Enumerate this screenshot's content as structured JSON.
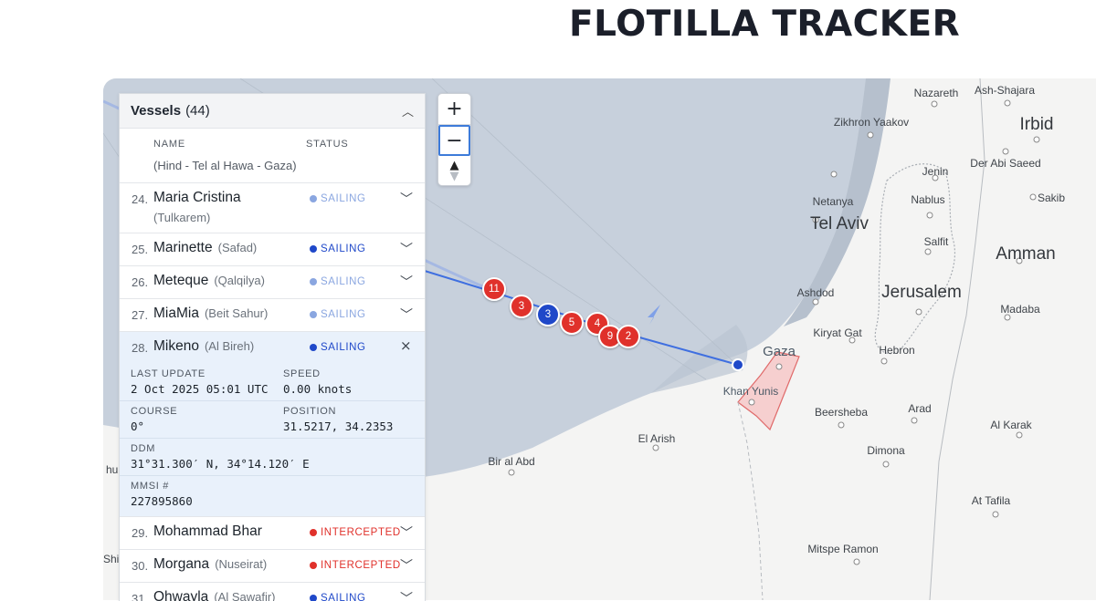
{
  "page": {
    "title": "FLOTILLA TRACKER"
  },
  "panel": {
    "title": "Vessels",
    "count": "(44)",
    "collapse_icon": "chevron-up-icon",
    "columns": {
      "name": "NAME",
      "status": "STATUS"
    },
    "prev_subtitle": "(Hind - Tel al Hawa - Gaza)",
    "vessels": [
      {
        "number": "24.",
        "name": "Maria Cristina",
        "subtitle": "(Tulkarem)",
        "status": "SAILING",
        "status_color": "#8aa6e0"
      },
      {
        "number": "25.",
        "name": "Marinette",
        "subtitle": "(Safad)",
        "status": "SAILING",
        "status_color": "#1f48c9"
      },
      {
        "number": "26.",
        "name": "Meteque",
        "subtitle": "(Qalqilya)",
        "status": "SAILING",
        "status_color": "#8aa6e0"
      },
      {
        "number": "27.",
        "name": "MiaMia",
        "subtitle": "(Beit Sahur)",
        "status": "SAILING",
        "status_color": "#8aa6e0"
      }
    ],
    "selected": {
      "number": "28.",
      "name": "Mikeno",
      "subtitle": "(Al Bireh)",
      "status": "SAILING",
      "status_color": "#1f48c9",
      "last_update_label": "LAST UPDATE",
      "last_update": "2 Oct 2025 05:01 UTC",
      "speed_label": "SPEED",
      "speed": "0.00 knots",
      "course_label": "COURSE",
      "course": "0°",
      "position_label": "POSITION",
      "position": "31.5217, 34.2353",
      "ddm_label": "DDM",
      "ddm": "31°31.300′ N, 34°14.120′ E",
      "mmsi_label": "MMSI #",
      "mmsi": "227895860"
    },
    "vessels_after": [
      {
        "number": "29.",
        "name": "Mohammad Bhar",
        "subtitle": "",
        "status": "INTERCEPTED",
        "status_color": "#e0312b"
      },
      {
        "number": "30.",
        "name": "Morgana",
        "subtitle": "(Nuseirat)",
        "status": "INTERCEPTED",
        "status_color": "#e0312b"
      },
      {
        "number": "31.",
        "name": "Ohwayla",
        "subtitle": "(Al Sawafir)",
        "status": "SAILING",
        "status_color": "#1f48c9"
      }
    ]
  },
  "zoom": {
    "in": "+",
    "out": "−",
    "compass_icon": "compass-icon"
  },
  "map": {
    "places": [
      {
        "name": "Nazareth",
        "size": "small"
      },
      {
        "name": "Ash-Shajara",
        "size": "small"
      },
      {
        "name": "Irbid",
        "size": "big"
      },
      {
        "name": "Zikhron Yaakov",
        "size": "small"
      },
      {
        "name": "Der Abi Saeed",
        "size": "small"
      },
      {
        "name": "Jenin",
        "size": "small"
      },
      {
        "name": "Netanya",
        "size": "small"
      },
      {
        "name": "Nablus",
        "size": "small"
      },
      {
        "name": "Sakib",
        "size": "small"
      },
      {
        "name": "Tel Aviv",
        "size": "big"
      },
      {
        "name": "Salfit",
        "size": "small"
      },
      {
        "name": "Amman",
        "size": "big"
      },
      {
        "name": "Ashdod",
        "size": "small"
      },
      {
        "name": "Jerusalem",
        "size": "big"
      },
      {
        "name": "Madaba",
        "size": "small"
      },
      {
        "name": "Kiryat Gat",
        "size": "small"
      },
      {
        "name": "Gaza",
        "size": "medium"
      },
      {
        "name": "Hebron",
        "size": "small"
      },
      {
        "name": "Khan Yunis",
        "size": "small"
      },
      {
        "name": "Beersheba",
        "size": "small"
      },
      {
        "name": "Arad",
        "size": "small"
      },
      {
        "name": "Al Karak",
        "size": "small"
      },
      {
        "name": "El Arish",
        "size": "small"
      },
      {
        "name": "Dimona",
        "size": "small"
      },
      {
        "name": "Bir al Abd",
        "size": "small"
      },
      {
        "name": "At Tafila",
        "size": "small"
      },
      {
        "name": "Mitspe Ramon",
        "size": "small"
      },
      {
        "name": "hub",
        "size": "small"
      },
      {
        "name": "Shil",
        "size": "small"
      }
    ],
    "markers": [
      {
        "label": "11",
        "color": "red"
      },
      {
        "label": "3",
        "color": "red"
      },
      {
        "label": "3",
        "color": "blue"
      },
      {
        "label": "5",
        "color": "red"
      },
      {
        "label": "4",
        "color": "red"
      },
      {
        "label": "9",
        "color": "red"
      },
      {
        "label": "2",
        "color": "red"
      }
    ]
  }
}
